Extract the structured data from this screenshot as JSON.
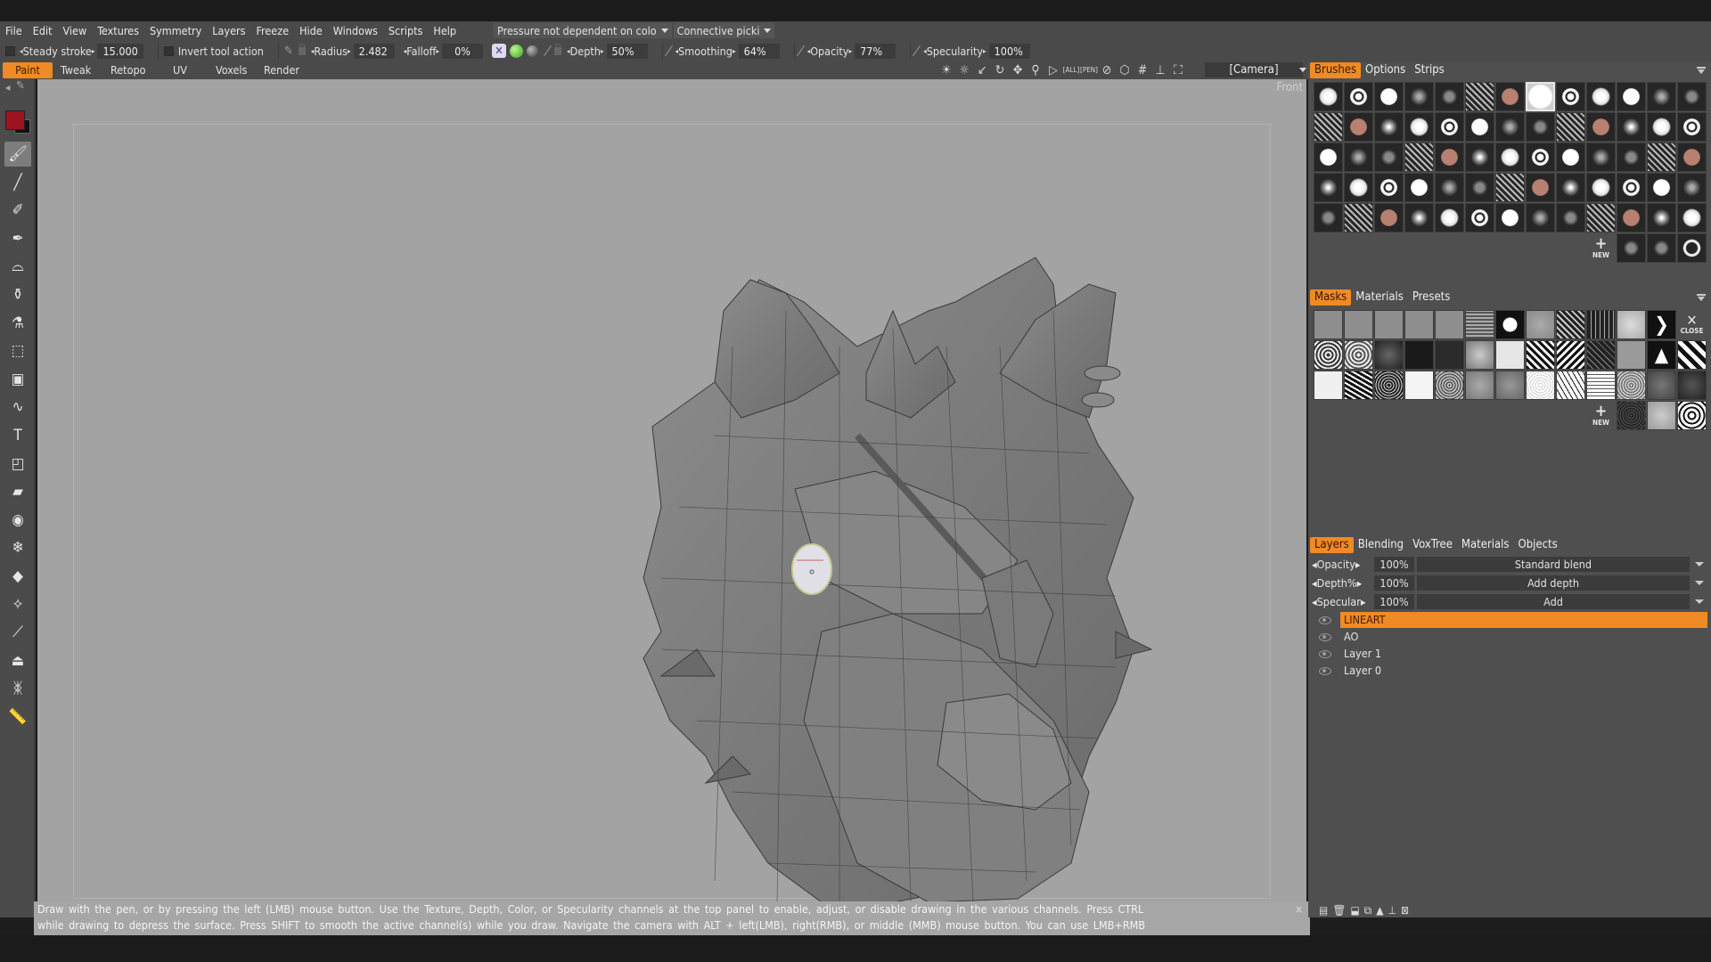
{
  "menubar": {
    "items": [
      "File",
      "Edit",
      "View",
      "Textures",
      "Symmetry",
      "Layers",
      "Freeze",
      "Hide",
      "Windows",
      "Scripts",
      "Help"
    ],
    "pressure_dropdown": "Pressure not dependent on colo",
    "pick_dropdown": "Connective picki"
  },
  "toolbar": {
    "steady_stroke_label": "Steady stroke",
    "steady_stroke_value": "15.000",
    "invert_label": "Invert tool action",
    "radius_label": "Radius",
    "radius_value": "2.482",
    "falloff_label": "Falloff",
    "falloff_value": "0%",
    "depth_label": "Depth",
    "depth_value": "50%",
    "smoothing_label": "Smoothing",
    "smoothing_value": "64%",
    "opacity_label": "Opacity",
    "opacity_value": "77%",
    "specularity_label": "Specularity",
    "specularity_value": "100%"
  },
  "modes": {
    "tabs": [
      "Paint",
      "Tweak",
      "Retopo",
      "UV",
      "Voxels",
      "Render"
    ],
    "active": "Paint"
  },
  "viewport": {
    "camera": "[Camera]",
    "view_label": "Front",
    "icons": [
      "light-icon",
      "bulb-icon",
      "light-direction-icon",
      "rotate-icon",
      "move-icon",
      "zoom-icon",
      "play-icon",
      "frame-all-icon",
      "frame-pen-icon",
      "no-icon",
      "cube-icon",
      "grid-icon",
      "axis-icon",
      "fullscreen-icon"
    ],
    "help_line1": "Draw with the pen, or by pressing the left (LMB) mouse button. Use the Texture, Depth, Color, or Specularity channels at the top panel to enable, adjust, or disable drawing in the various channels. Press CTRL",
    "help_line2": "while drawing to depress the surface. Press SHIFT to smooth the active channel(s) while you draw. Navigate the camera with ALT + left(LMB), right(RMB), or middle (MMB) mouse button. You can use LMB+RMB",
    "help_close": "×"
  },
  "colors": {
    "accent": "#f08a24",
    "primary_color": "#9c1420",
    "viewport_bg": "#a3a3a3",
    "panel_bg": "#4f4f4f"
  },
  "left_tools": [
    "brush-icon",
    "line-icon",
    "airbrush-icon",
    "pen-fade-icon",
    "smudge-icon",
    "bottle-icon",
    "stamp-icon",
    "lasso-icon",
    "fill-icon",
    "curve-icon",
    "text-icon",
    "rect-select-icon",
    "eraser-icon",
    "eye-icon",
    "freeze-icon",
    "fill-bucket-icon",
    "magic-wand-icon",
    "dropper-icon",
    "iron-icon",
    "butterfly-icon",
    "ruler-icon"
  ],
  "brushes_panel": {
    "tabs": [
      "Brushes",
      "Options",
      "Strips"
    ],
    "active": "Brushes",
    "new_label": "NEW"
  },
  "masks_panel": {
    "tabs": [
      "Masks",
      "Materials",
      "Presets"
    ],
    "active": "Masks",
    "new_label": "NEW",
    "close_label": "CLOSE"
  },
  "layers_panel": {
    "tabs": [
      "Layers",
      "Blending",
      "VoxTree",
      "Materials",
      "Objects"
    ],
    "active": "Layers",
    "props": [
      {
        "label": "Opacity",
        "value": "100%",
        "mode": "Standard blend"
      },
      {
        "label": "Depth%",
        "value": "100%",
        "mode": "Add depth"
      },
      {
        "label": "Specular",
        "value": "100%",
        "mode": "Add"
      }
    ],
    "layers": [
      {
        "name": "LINEART",
        "active": true
      },
      {
        "name": "AO",
        "active": false
      },
      {
        "name": "Layer 1",
        "active": false
      },
      {
        "name": "Layer 0",
        "active": false
      }
    ]
  }
}
